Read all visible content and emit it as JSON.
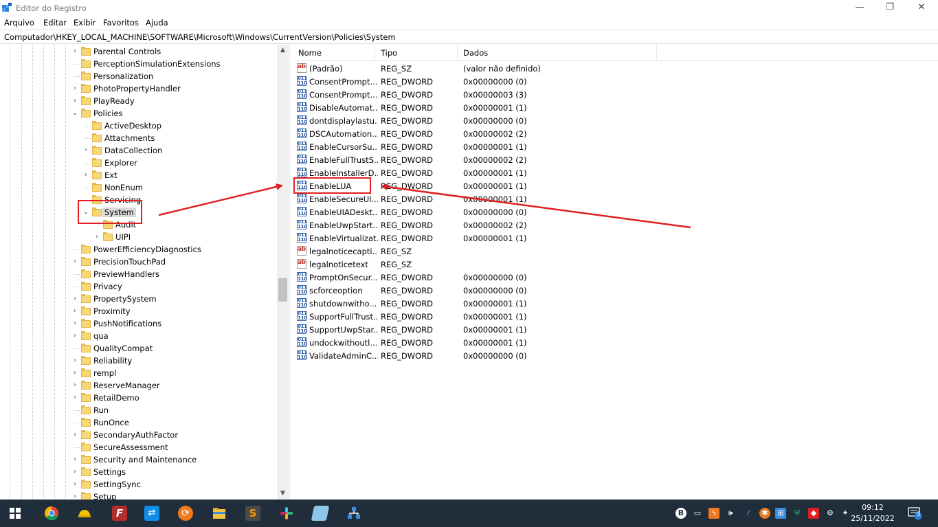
{
  "window": {
    "title": "Editor do Registro",
    "controls": {
      "minimize": "—",
      "maximize": "❐",
      "close": "✕"
    }
  },
  "menu": [
    "Arquivo",
    "Editar",
    "Exibir",
    "Favoritos",
    "Ajuda"
  ],
  "address": "Computador\\HKEY_LOCAL_MACHINE\\SOFTWARE\\Microsoft\\Windows\\CurrentVersion\\Policies\\System",
  "tree": {
    "items": [
      {
        "label": "Parental Controls",
        "expander": "›"
      },
      {
        "label": "PerceptionSimulationExtensions",
        "expander": ""
      },
      {
        "label": "Personalization",
        "expander": ""
      },
      {
        "label": "PhotoPropertyHandler",
        "expander": "›"
      },
      {
        "label": "PlayReady",
        "expander": "›"
      },
      {
        "label": "Policies",
        "expander": "⌄"
      },
      {
        "label": "ActiveDesktop",
        "expander": ""
      },
      {
        "label": "Attachments",
        "expander": ""
      },
      {
        "label": "DataCollection",
        "expander": "›"
      },
      {
        "label": "Explorer",
        "expander": ""
      },
      {
        "label": "Ext",
        "expander": "›"
      },
      {
        "label": "NonEnum",
        "expander": ""
      },
      {
        "label": "Servicing",
        "expander": ""
      },
      {
        "label": "System",
        "expander": "⌄"
      },
      {
        "label": "Audit",
        "expander": ""
      },
      {
        "label": "UIPI",
        "expander": "›"
      },
      {
        "label": "PowerEfficiencyDiagnostics",
        "expander": ""
      },
      {
        "label": "PrecisionTouchPad",
        "expander": "›"
      },
      {
        "label": "PreviewHandlers",
        "expander": ""
      },
      {
        "label": "Privacy",
        "expander": ""
      },
      {
        "label": "PropertySystem",
        "expander": "›"
      },
      {
        "label": "Proximity",
        "expander": "›"
      },
      {
        "label": "PushNotifications",
        "expander": "›"
      },
      {
        "label": "qua",
        "expander": "›"
      },
      {
        "label": "QualityCompat",
        "expander": ""
      },
      {
        "label": "Reliability",
        "expander": "›"
      },
      {
        "label": "rempl",
        "expander": "›"
      },
      {
        "label": "ReserveManager",
        "expander": "›"
      },
      {
        "label": "RetailDemo",
        "expander": "›"
      },
      {
        "label": "Run",
        "expander": ""
      },
      {
        "label": "RunOnce",
        "expander": ""
      },
      {
        "label": "SecondaryAuthFactor",
        "expander": "›"
      },
      {
        "label": "SecureAssessment",
        "expander": ""
      },
      {
        "label": "Security and Maintenance",
        "expander": "›"
      },
      {
        "label": "Settings",
        "expander": "›"
      },
      {
        "label": "SettingSync",
        "expander": "›"
      },
      {
        "label": "Setup",
        "expander": "›"
      }
    ]
  },
  "list": {
    "columns": [
      "Nome",
      "Tipo",
      "Dados"
    ],
    "rows": [
      {
        "icon": "string-icon",
        "name": "(Padrão)",
        "type": "REG_SZ",
        "data": "(valor não definido)"
      },
      {
        "icon": "dword-icon",
        "name": "ConsentPrompt...",
        "type": "REG_DWORD",
        "data": "0x00000000 (0)"
      },
      {
        "icon": "dword-icon",
        "name": "ConsentPrompt...",
        "type": "REG_DWORD",
        "data": "0x00000003 (3)"
      },
      {
        "icon": "dword-icon",
        "name": "DisableAutomat...",
        "type": "REG_DWORD",
        "data": "0x00000001 (1)"
      },
      {
        "icon": "dword-icon",
        "name": "dontdisplaylastu...",
        "type": "REG_DWORD",
        "data": "0x00000000 (0)"
      },
      {
        "icon": "dword-icon",
        "name": "DSCAutomation...",
        "type": "REG_DWORD",
        "data": "0x00000002 (2)"
      },
      {
        "icon": "dword-icon",
        "name": "EnableCursorSu...",
        "type": "REG_DWORD",
        "data": "0x00000001 (1)"
      },
      {
        "icon": "dword-icon",
        "name": "EnableFullTrustS...",
        "type": "REG_DWORD",
        "data": "0x00000002 (2)"
      },
      {
        "icon": "dword-icon",
        "name": "EnableInstallerD...",
        "type": "REG_DWORD",
        "data": "0x00000001 (1)"
      },
      {
        "icon": "dword-icon",
        "name": "EnableLUA",
        "type": "REG_DWORD",
        "data": "0x00000001 (1)"
      },
      {
        "icon": "dword-icon",
        "name": "EnableSecureUI...",
        "type": "REG_DWORD",
        "data": "0x00000001 (1)"
      },
      {
        "icon": "dword-icon",
        "name": "EnableUIADeskt...",
        "type": "REG_DWORD",
        "data": "0x00000000 (0)"
      },
      {
        "icon": "dword-icon",
        "name": "EnableUwpStart...",
        "type": "REG_DWORD",
        "data": "0x00000002 (2)"
      },
      {
        "icon": "dword-icon",
        "name": "EnableVirtualizat...",
        "type": "REG_DWORD",
        "data": "0x00000001 (1)"
      },
      {
        "icon": "string-icon",
        "name": "legalnoticecapti...",
        "type": "REG_SZ",
        "data": ""
      },
      {
        "icon": "string-icon",
        "name": "legalnoticetext",
        "type": "REG_SZ",
        "data": ""
      },
      {
        "icon": "dword-icon",
        "name": "PromptOnSecur...",
        "type": "REG_DWORD",
        "data": "0x00000000 (0)"
      },
      {
        "icon": "dword-icon",
        "name": "scforceoption",
        "type": "REG_DWORD",
        "data": "0x00000000 (0)"
      },
      {
        "icon": "dword-icon",
        "name": "shutdownwitho...",
        "type": "REG_DWORD",
        "data": "0x00000001 (1)"
      },
      {
        "icon": "dword-icon",
        "name": "SupportFullTrust...",
        "type": "REG_DWORD",
        "data": "0x00000001 (1)"
      },
      {
        "icon": "dword-icon",
        "name": "SupportUwpStar...",
        "type": "REG_DWORD",
        "data": "0x00000001 (1)"
      },
      {
        "icon": "dword-icon",
        "name": "undockwithoutl...",
        "type": "REG_DWORD",
        "data": "0x00000001 (1)"
      },
      {
        "icon": "dword-icon",
        "name": "ValidateAdminC...",
        "type": "REG_DWORD",
        "data": "0x00000000 (0)"
      }
    ]
  },
  "icon_text": {
    "string": "ab",
    "dword": "011 110"
  },
  "taskbar": {
    "apps": [
      "start-icon",
      "chrome-icon",
      "worker-helmet-icon",
      "filezilla-icon",
      "teamviewer-icon",
      "sync-icon",
      "file-explorer-icon",
      "sublime-icon",
      "slack-icon",
      "notepad-icon",
      "network-app-icon"
    ],
    "tray_letter": "B",
    "tray_icons": [
      "monitor-icon",
      "lightning-icon",
      "speaker-icon",
      "feather-icon",
      "orange-app-icon",
      "network-icon",
      "shield-icon",
      "anydesk-icon",
      "settings-icon",
      "wifi-icon"
    ],
    "time": "09:12",
    "date": "25/11/2022",
    "notification_count": "5"
  },
  "colors": {
    "annotation": "#e02020",
    "taskbar": "#1f2e3a",
    "folder": "#f8d775"
  }
}
